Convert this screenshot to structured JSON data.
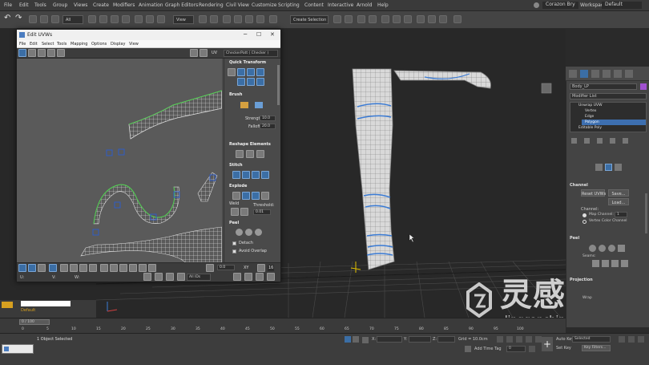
{
  "menubar": {
    "items": [
      "File",
      "Edit",
      "Tools",
      "Group",
      "Views",
      "Create",
      "Modifiers",
      "Animation",
      "Graph Editors",
      "Rendering",
      "Civil View",
      "Customize",
      "Scripting",
      "Content",
      "Interactive",
      "Arnold",
      "Help"
    ],
    "user": "Corazon Bry",
    "workspaces_label": "Workspaces:",
    "workspace": "Default"
  },
  "toolbar": {
    "filter": "All",
    "view": "View",
    "selection_set": "Create Selection Se"
  },
  "uv_editor": {
    "title": "Edit UVWs",
    "menus": [
      "File",
      "Edit",
      "Select",
      "Tools",
      "Mapping",
      "Options",
      "Display",
      "View"
    ],
    "uv_label": "UV",
    "checker": "CheckerPatt ( Checker )",
    "quick_transform": "Quick Transform",
    "brush": "Brush",
    "strength_label": "Strength:",
    "strength_value": "10.0",
    "falloff_label": "Falloff:",
    "falloff_value": "20.0",
    "reshape": "Reshape Elements",
    "stitch": "Stitch",
    "explode": "Explode",
    "weld": "Weld",
    "threshold_label": "Threshold:",
    "threshold_value": "0.01",
    "peel": "Peel",
    "detach": "Detach",
    "avoid_overlap": "Avoid Overlap",
    "bottom_value": "0.0",
    "xy": "XY",
    "all_ids": "All IDs",
    "coord_u": "U:",
    "coord_v": "V:",
    "coord_w": "W:",
    "pct": "16"
  },
  "command_panel": {
    "object_name": "Body_LP",
    "modifier_list": "Modifier List",
    "stack": [
      "Unwrap UVW",
      "Vertex",
      "Edge",
      "Polygon",
      "Editable Poly"
    ],
    "channel_title": "Channel",
    "reset_uvws": "Reset UVWs",
    "save": "Save...",
    "load": "Load...",
    "channel_label": "Channel:",
    "map_channel": "Map Channel:",
    "map_channel_value": "1",
    "vertex_color_channel": "Vertex Color Channel",
    "peel_title": "Peel",
    "seams": "Seams:",
    "projection_title": "Projection",
    "wrap": "Wrap"
  },
  "timeline": {
    "frame": "0 / 100",
    "ticks": [
      "0",
      "5",
      "10",
      "15",
      "20",
      "25",
      "30",
      "35",
      "40",
      "45",
      "50",
      "55",
      "60",
      "65",
      "70",
      "75",
      "80",
      "85",
      "90",
      "95",
      "100"
    ]
  },
  "layer": {
    "name": "Default"
  },
  "statusbar": {
    "selected": "1 Object Selected",
    "x_label": "X:",
    "y_label": "Y:",
    "z_label": "Z:",
    "grid": "Grid = 10.0cm",
    "add_time_tag": "Add Time Tag",
    "auto_key": "Auto Key",
    "selected_dropdown": "Selected",
    "set_key": "Set Key",
    "key_filters": "Key Filters...",
    "frame_value": "0"
  },
  "watermark": {
    "cn": "灵感中国",
    "url": "lingganchina.com"
  },
  "colors": {
    "accent_blue": "#3b6ea5",
    "uv_green": "#4fd04f",
    "seam_blue": "#3a7bd5",
    "selected_row": "#3d6fb0"
  }
}
